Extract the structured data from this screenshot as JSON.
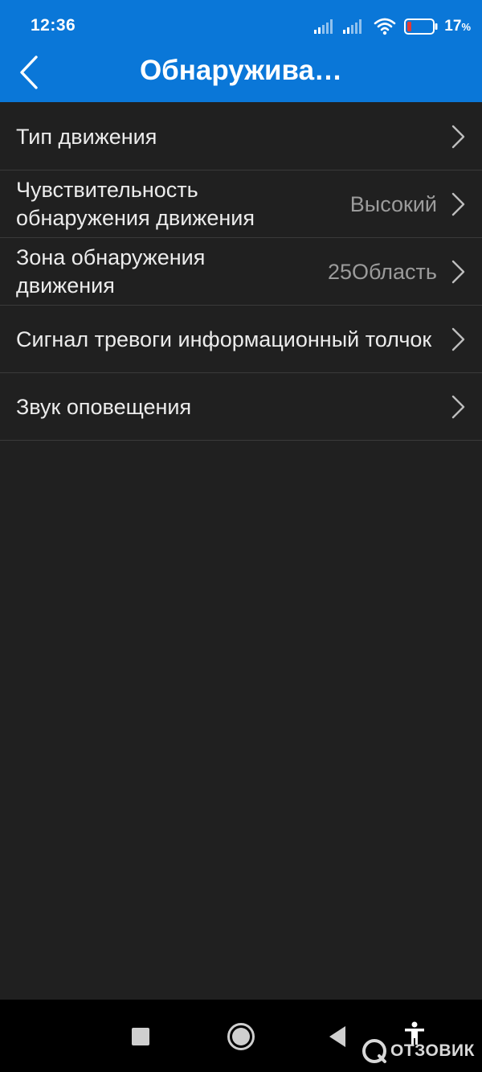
{
  "status_bar": {
    "time": "12:36",
    "battery_level": "17",
    "battery_unit": "%",
    "icons": [
      "signal-icon",
      "signal-icon",
      "wifi-icon",
      "battery-icon"
    ]
  },
  "header": {
    "title": "Обнаружива…",
    "back_icon": "chevron-left-icon",
    "background_color": "#0a77d8"
  },
  "settings": {
    "items": [
      {
        "label": "Тип движения",
        "value": ""
      },
      {
        "label": "Чувствительность обнаружения движения",
        "value": "Высокий"
      },
      {
        "label": "Зона обнаружения движения",
        "value": "25Область"
      },
      {
        "label": "Сигнал тревоги информационный толчок",
        "value": ""
      },
      {
        "label": "Звук оповещения",
        "value": ""
      }
    ]
  },
  "nav_bar": {
    "buttons": [
      "recents-square-icon",
      "home-circle-icon",
      "back-triangle-icon",
      "accessibility-icon"
    ]
  },
  "watermark": {
    "text": "ОТЗОВИК"
  }
}
